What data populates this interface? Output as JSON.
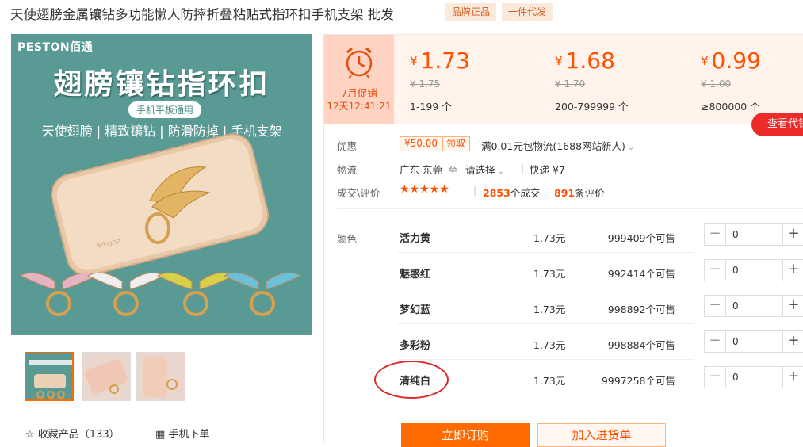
{
  "product": {
    "title": "天使翅膀金属镶钻多功能懒人防摔折叠粘贴式指环扣手机支架 批发",
    "tags": [
      "品牌正品",
      "一件代发"
    ]
  },
  "main_image": {
    "brand": "PESTON佰通",
    "headline": "翅膀镶钻指环扣",
    "pill": "手机平板通用",
    "slogan": "天使翅膀 | 精致镶钻 | 防滑防掉 | 手机支架"
  },
  "bottom_links": {
    "favorite": "收藏产品（133）",
    "mobile": "手机下单"
  },
  "promo": {
    "label": "7月促销",
    "countdown": "12天12:41:21"
  },
  "price_tiers": [
    {
      "yen": "¥",
      "price": "1.73",
      "original": "¥ 1.75",
      "range": "1-199 个"
    },
    {
      "yen": "¥",
      "price": "1.68",
      "original": "¥ 1.70",
      "range": "200-799999 个"
    },
    {
      "yen": "¥",
      "price": "0.99",
      "original": "¥ 1.00",
      "range": "≥800000 个"
    }
  ],
  "agent_button": "查看代销",
  "info": {
    "discount_label": "优惠",
    "coupon_amount": "¥50.00",
    "coupon_get": "领取",
    "discount_text": "满0.01元包物流(1688网站新人)",
    "logistics_label": "物流",
    "origin": "广东 东莞",
    "to": "至",
    "destination": "请选择",
    "shipping": "快递 ¥7",
    "reviews_label": "成交\\评价",
    "stars": "★★★★★",
    "deals_count": "2853",
    "deals_suffix": "个成交",
    "reviews_count": "891",
    "reviews_suffix": "条评价"
  },
  "color_label": "颜色",
  "skus": [
    {
      "name": "活力黄",
      "price": "1.73元",
      "stock": "999409个可售",
      "qty": "0"
    },
    {
      "name": "魅惑红",
      "price": "1.73元",
      "stock": "992414个可售",
      "qty": "0"
    },
    {
      "name": "梦幻蓝",
      "price": "1.73元",
      "stock": "998892个可售",
      "qty": "0"
    },
    {
      "name": "多彩粉",
      "price": "1.73元",
      "stock": "998884个可售",
      "qty": "0"
    },
    {
      "name": "清纯白",
      "price": "1.73元",
      "stock": "9997258个可售",
      "qty": "0"
    }
  ],
  "stepper_minus": "−",
  "stepper_plus": "+",
  "buttons": {
    "buy": "立即订购",
    "cart": "加入进货单"
  },
  "colors": {
    "accent": "#ff5000",
    "promo_bg": "#ffd3c1",
    "price_bg": "#fff3ec",
    "agent_red": "#ec2b2b",
    "annotation_circle": "#e02828"
  }
}
